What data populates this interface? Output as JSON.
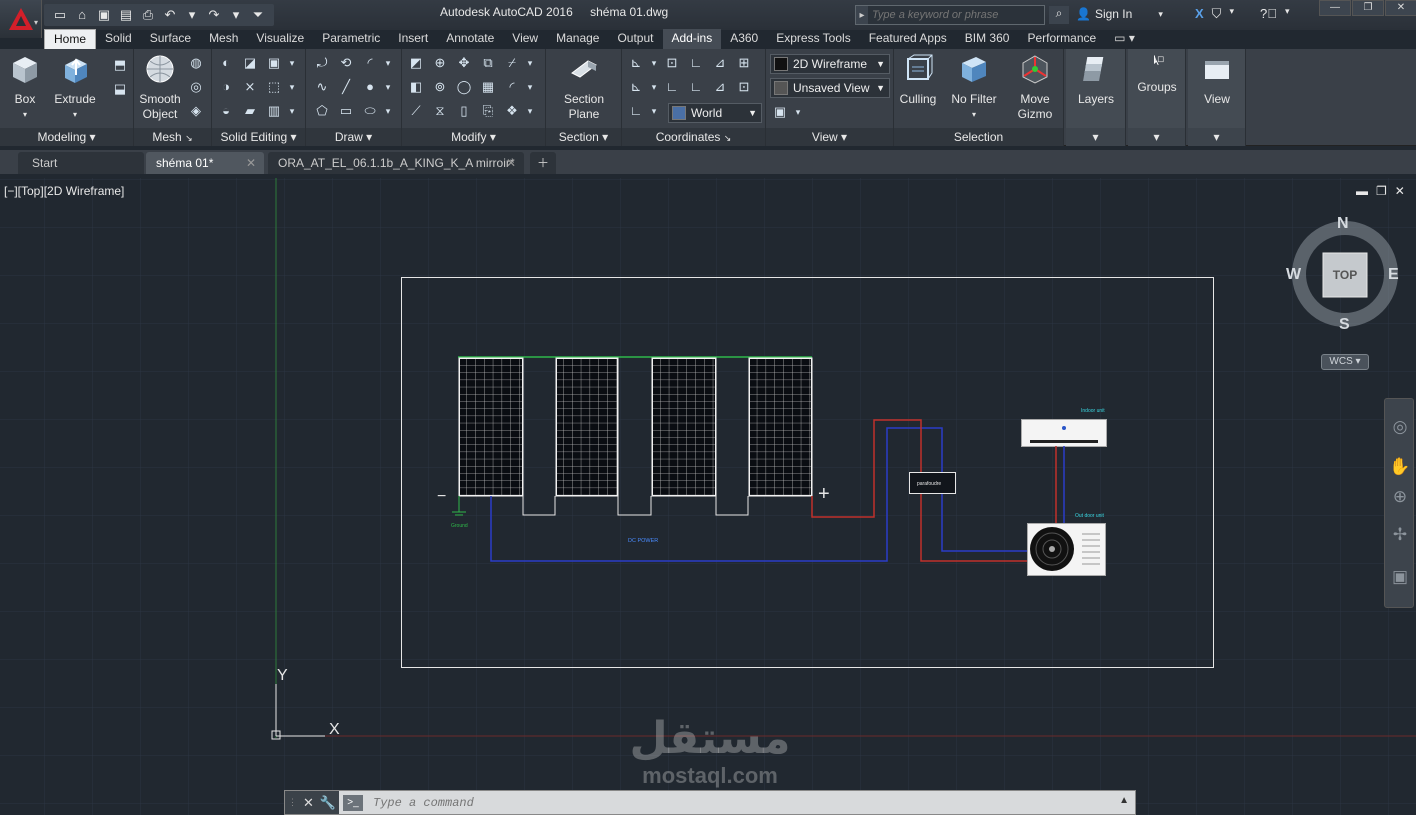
{
  "title_bar": {
    "app_name": "Autodesk AutoCAD 2016",
    "file_name": "shéma 01.dwg",
    "search_placeholder": "Type a keyword or phrase",
    "sign_in": "Sign In"
  },
  "ribbon_tabs": [
    "Home",
    "Solid",
    "Surface",
    "Mesh",
    "Visualize",
    "Parametric",
    "Insert",
    "Annotate",
    "View",
    "Manage",
    "Output",
    "Add-ins",
    "A360",
    "Express Tools",
    "Featured Apps",
    "BIM 360",
    "Performance"
  ],
  "ribbon": {
    "modeling": {
      "title": "Modeling",
      "box": "Box",
      "extrude": "Extrude"
    },
    "mesh": {
      "title": "Mesh",
      "smooth_object": "Smooth Object"
    },
    "solid_editing": {
      "title": "Solid Editing"
    },
    "draw": {
      "title": "Draw"
    },
    "modify": {
      "title": "Modify"
    },
    "section": {
      "title": "Section",
      "section_plane": "Section Plane"
    },
    "coordinates": {
      "title": "Coordinates",
      "ucs_value": "World"
    },
    "view": {
      "title": "View",
      "visual_style": "2D Wireframe",
      "named_view": "Unsaved View"
    },
    "selection": {
      "title": "Selection",
      "culling": "Culling",
      "no_filter": "No Filter",
      "move_gizmo": "Move Gizmo"
    },
    "layers": "Layers",
    "groups": "Groups",
    "view_btn": "View"
  },
  "doc_tabs": [
    "Start",
    "shéma 01*",
    "ORA_AT_EL_06.1.1b_A_KING_K_A mirroir*"
  ],
  "viewport_label": "[−][Top][2D Wireframe]",
  "viewcube": {
    "top": "TOP",
    "n": "N",
    "s": "S",
    "e": "E",
    "w": "W",
    "wcs": "WCS"
  },
  "drawing": {
    "labels": {
      "ground": "Ground",
      "dc_power": "DC POWER",
      "indoor_unit": "Indoor unit",
      "outdoor_unit": "Out door unit",
      "controller": "parafoudre",
      "minus": "−",
      "plus": "+"
    },
    "ucs": {
      "x": "X",
      "y": "Y"
    }
  },
  "command_line": {
    "placeholder": "Type a command"
  },
  "watermark": {
    "arabic": "مستقل",
    "latin": "mostaql.com"
  },
  "colors": {
    "background": "#212830",
    "grid": "#2b3340",
    "red_wire": "#c0302a",
    "blue_wire": "#2a3cc8",
    "accent": "#d31f2a"
  }
}
